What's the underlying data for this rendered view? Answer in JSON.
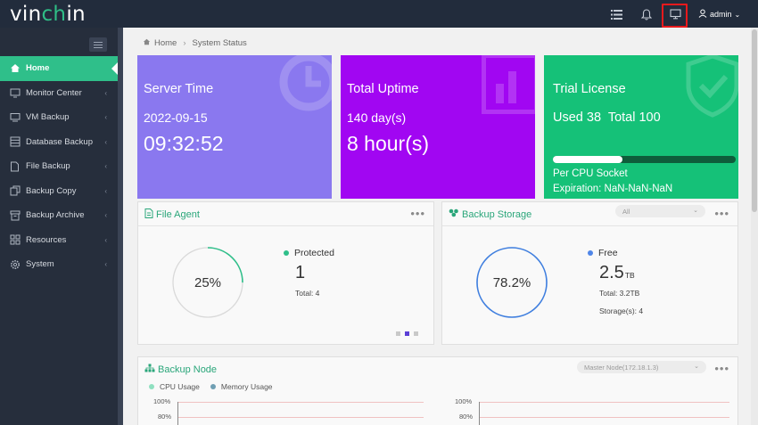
{
  "app": {
    "logo_main": "vin",
    "logo_accent": "ch",
    "logo_end": "in",
    "user": "admin"
  },
  "colors": {
    "topbar": "#222c3c",
    "sidebar": "#262e3c",
    "accent": "#2fbf8a",
    "server_time_card": "#8a78ef",
    "uptime_card": "#a106f2",
    "license_card": "#15c178"
  },
  "sidebar": {
    "items": [
      {
        "label": "Home",
        "icon": "home-icon",
        "active": true
      },
      {
        "label": "Monitor Center",
        "icon": "monitor-icon"
      },
      {
        "label": "VM Backup",
        "icon": "vm-icon"
      },
      {
        "label": "Database Backup",
        "icon": "database-icon"
      },
      {
        "label": "File Backup",
        "icon": "file-icon"
      },
      {
        "label": "Backup Copy",
        "icon": "copy-icon"
      },
      {
        "label": "Backup Archive",
        "icon": "archive-icon"
      },
      {
        "label": "Resources",
        "icon": "resources-icon"
      },
      {
        "label": "System",
        "icon": "gear-icon"
      }
    ]
  },
  "breadcrumb": {
    "home": "Home",
    "current": "System Status"
  },
  "cards": {
    "server_time": {
      "title": "Server Time",
      "date": "2022-09-15",
      "time": "09:32:52"
    },
    "uptime": {
      "title": "Total Uptime",
      "days": "140 day(s)",
      "hours": "8 hour(s)"
    },
    "license": {
      "title": "Trial License",
      "used": "Used 38",
      "total": "Total 100",
      "used_fraction": 0.38,
      "type": "Per CPU Socket",
      "expiration": "Expiration: NaN-NaN-NaN"
    }
  },
  "file_agent": {
    "title": "File Agent",
    "percent": "25%",
    "fraction": 0.25,
    "label": "Protected",
    "value": "1",
    "total": "Total: 4",
    "pages": 3,
    "current_page": 2
  },
  "backup_storage": {
    "title": "Backup Storage",
    "select": "All",
    "percent": "78.2%",
    "fraction": 1.0,
    "label": "Free",
    "value": "2.5",
    "unit": "TB",
    "total": "Total: 3.2TB",
    "storages": "Storage(s): 4"
  },
  "backup_node": {
    "title": "Backup Node",
    "select": "Master Node(172.18.1.3)",
    "legend": [
      "CPU Usage",
      "Memory Usage"
    ],
    "ticks": [
      "100%",
      "80%"
    ]
  }
}
